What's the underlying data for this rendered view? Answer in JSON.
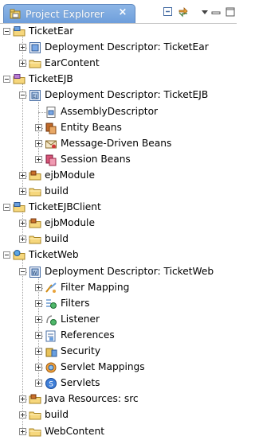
{
  "view": {
    "tab_label": "Project Explorer",
    "tab_close": "×"
  },
  "tree": [
    {
      "label": "TicketEar",
      "icon": "ear-project-icon",
      "depth": 0,
      "toggle": "minus"
    },
    {
      "label": "Deployment Descriptor: TicketEar",
      "icon": "deployment-descriptor-icon",
      "depth": 1,
      "toggle": "plus"
    },
    {
      "label": "EarContent",
      "icon": "folder-icon",
      "depth": 1,
      "toggle": "plus"
    },
    {
      "label": "TicketEJB",
      "icon": "ejb-project-icon",
      "depth": 0,
      "toggle": "minus"
    },
    {
      "label": "Deployment Descriptor: TicketEJB",
      "icon": "ejb-deployment-descriptor-icon",
      "depth": 1,
      "toggle": "minus"
    },
    {
      "label": "AssemblyDescriptor",
      "icon": "assembly-descriptor-icon",
      "depth": 2,
      "toggle": "none"
    },
    {
      "label": "Entity Beans",
      "icon": "entity-beans-icon",
      "depth": 2,
      "toggle": "plus"
    },
    {
      "label": "Message-Driven Beans",
      "icon": "message-driven-beans-icon",
      "depth": 2,
      "toggle": "plus"
    },
    {
      "label": "Session Beans",
      "icon": "session-beans-icon",
      "depth": 2,
      "toggle": "plus"
    },
    {
      "label": "ejbModule",
      "icon": "source-folder-icon",
      "depth": 1,
      "toggle": "plus"
    },
    {
      "label": "build",
      "icon": "folder-icon",
      "depth": 1,
      "toggle": "plus"
    },
    {
      "label": "TicketEJBClient",
      "icon": "java-project-icon",
      "depth": 0,
      "toggle": "minus"
    },
    {
      "label": "ejbModule",
      "icon": "source-folder-icon",
      "depth": 1,
      "toggle": "plus"
    },
    {
      "label": "build",
      "icon": "folder-icon",
      "depth": 1,
      "toggle": "plus"
    },
    {
      "label": "TicketWeb",
      "icon": "web-project-icon",
      "depth": 0,
      "toggle": "minus"
    },
    {
      "label": "Deployment Descriptor: TicketWeb",
      "icon": "web-deployment-descriptor-icon",
      "depth": 1,
      "toggle": "minus"
    },
    {
      "label": "Filter Mapping",
      "icon": "filter-mapping-icon",
      "depth": 2,
      "toggle": "plus"
    },
    {
      "label": "Filters",
      "icon": "filters-icon",
      "depth": 2,
      "toggle": "plus"
    },
    {
      "label": "Listener",
      "icon": "listener-icon",
      "depth": 2,
      "toggle": "plus"
    },
    {
      "label": "References",
      "icon": "references-icon",
      "depth": 2,
      "toggle": "plus"
    },
    {
      "label": "Security",
      "icon": "security-icon",
      "depth": 2,
      "toggle": "plus"
    },
    {
      "label": "Servlet Mappings",
      "icon": "servlet-mappings-icon",
      "depth": 2,
      "toggle": "plus"
    },
    {
      "label": "Servlets",
      "icon": "servlets-icon",
      "depth": 2,
      "toggle": "plus"
    },
    {
      "label": "Java Resources: src",
      "icon": "java-resources-icon",
      "depth": 1,
      "toggle": "plus"
    },
    {
      "label": "build",
      "icon": "folder-icon",
      "depth": 1,
      "toggle": "plus"
    },
    {
      "label": "WebContent",
      "icon": "folder-icon",
      "depth": 1,
      "toggle": "plus"
    }
  ]
}
